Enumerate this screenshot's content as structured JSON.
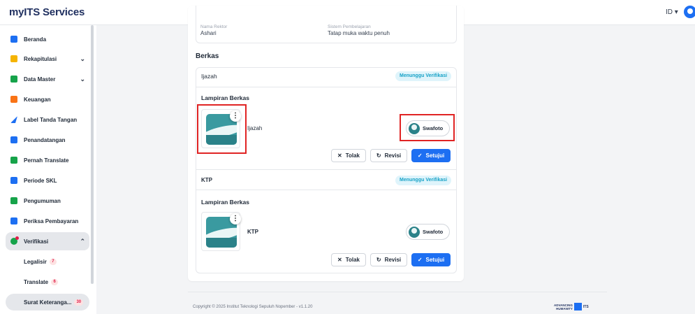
{
  "app": {
    "logo_prefix": "my",
    "logo_brand": "ITS",
    "logo_suffix": " Services",
    "language": "ID"
  },
  "sidebar": {
    "items": [
      {
        "label": "Beranda",
        "icon": "home-icon",
        "color": "#1d6ff2"
      },
      {
        "label": "Rekapitulasi",
        "icon": "table-icon",
        "color": "#f5b400",
        "expandable": true
      },
      {
        "label": "Data Master",
        "icon": "data-icon",
        "color": "#16a34a",
        "expandable": true
      },
      {
        "label": "Keuangan",
        "icon": "wallet-icon",
        "color": "#f97316"
      },
      {
        "label": "Label Tanda Tangan",
        "icon": "send-icon",
        "color": "#1d6ff2"
      },
      {
        "label": "Penandatangan",
        "icon": "signer-icon",
        "color": "#1d6ff2"
      },
      {
        "label": "Pernah Translate",
        "icon": "translate-icon",
        "color": "#16a34a"
      },
      {
        "label": "Periode SKL",
        "icon": "calendar-icon",
        "color": "#1d6ff2"
      },
      {
        "label": "Pengumuman",
        "icon": "announcement-icon",
        "color": "#16a34a"
      },
      {
        "label": "Periksa Pembayaran",
        "icon": "payment-check-icon",
        "color": "#1d6ff2"
      },
      {
        "label": "Verifikasi",
        "icon": "verify-icon",
        "color": "#16a34a",
        "expandable": true,
        "expanded": true
      }
    ],
    "sub_items": [
      {
        "label": "Legalisir",
        "badge": "7"
      },
      {
        "label": "Translate",
        "badge": "6"
      },
      {
        "label": "Surat Keteranga...",
        "badge": "30"
      }
    ]
  },
  "info": {
    "rektor_label": "Nama Rektor",
    "rektor_value": "Ashari",
    "sistem_label": "Sistem Pembelajaran",
    "sistem_value": "Tatap muka waktu penuh"
  },
  "berkas": {
    "title": "Berkas",
    "documents": [
      {
        "title": "Ijazah",
        "status": "Menunggu Verifikasi",
        "attachment_title": "Lampiran Berkas",
        "file_name": "Ijazah",
        "swafoto_label": "Swafoto",
        "reject_label": "Tolak",
        "revise_label": "Revisi",
        "approve_label": "Setujui"
      },
      {
        "title": "KTP",
        "status": "Menunggu Verifikasi",
        "attachment_title": "Lampiran Berkas",
        "file_name": "KTP",
        "swafoto_label": "Swafoto",
        "reject_label": "Tolak",
        "revise_label": "Revisi",
        "approve_label": "Setujui"
      }
    ]
  },
  "footer": {
    "copyright": "Copyright © 2025 Institut Teknologi Sepuluh Nopember - v1.1.20",
    "logo_line1": "ADVANCING",
    "logo_line2": "HUMANITY",
    "logo_brand": "ITS"
  },
  "colors": {
    "primary": "#1d6ff2",
    "status_bg": "#dff4fb",
    "status_text": "#17a2c7",
    "highlight": "#e02424",
    "badge_text": "#e11d48"
  }
}
